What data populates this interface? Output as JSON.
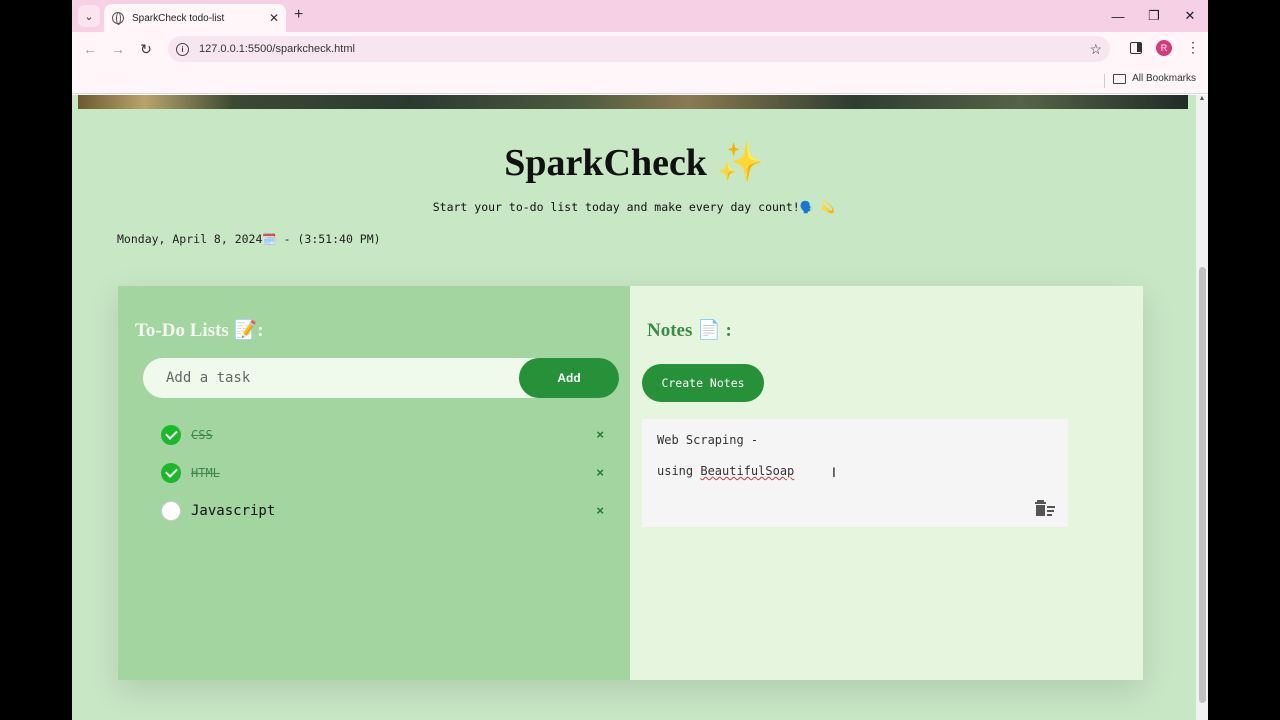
{
  "browser": {
    "tab_title": "SparkCheck todo-list",
    "url": "127.0.0.1:5500/sparkcheck.html",
    "bookmarks_label": "All Bookmarks",
    "profile_initial": "R"
  },
  "page": {
    "heading": "SparkCheck ✨",
    "subtitle": "Start your to-do list today and make every day count!🗣️ 💫",
    "datetime": "Monday, April 8, 2024🗓️ - (3:51:40 PM)"
  },
  "todo": {
    "title": "To-Do Lists 📝:",
    "input_placeholder": "Add a task",
    "add_label": "Add",
    "tasks": [
      {
        "text": "CSS",
        "done": true
      },
      {
        "text": "HTML",
        "done": true
      },
      {
        "text": "Javascript",
        "done": false
      }
    ],
    "delete_glyph": "×"
  },
  "notes": {
    "title": "Notes 📄 :",
    "create_label": "Create Notes",
    "note": {
      "line1": "Web Scraping -",
      "line2_prefix": "using ",
      "line2_word": "BeautifulSoap"
    }
  },
  "colors": {
    "accent": "#27913a",
    "todo_bg": "#a2d5a0",
    "notes_bg": "#e6f6de",
    "page_bg": "#c8e7c5",
    "tabstrip": "#f6d0e4"
  }
}
